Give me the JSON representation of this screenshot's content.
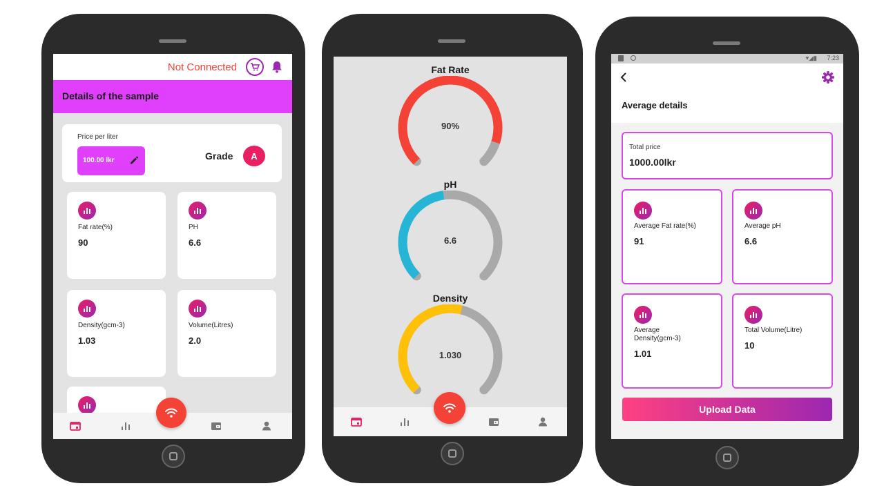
{
  "screen1": {
    "status_text": "Not Connected",
    "header_title": "Details of the sample",
    "price_label": "Price per liter",
    "price_value": "100.00 lkr",
    "grade_label": "Grade",
    "grade_value": "A",
    "metrics": [
      {
        "label": "Fat rate(%)",
        "value": "90"
      },
      {
        "label": "PH",
        "value": "6.6"
      },
      {
        "label": "Density(gcm-3)",
        "value": "1.03"
      },
      {
        "label": "Volume(Litres)",
        "value": "2.0"
      }
    ],
    "nav_icons": [
      "calendar-icon",
      "chart-icon",
      "wifi-icon",
      "wallet-icon",
      "person-icon"
    ]
  },
  "screen2": {
    "gauges": [
      {
        "title": "Fat Rate",
        "value_text": "90%",
        "fraction": 0.9,
        "color": "#f44336"
      },
      {
        "title": "pH",
        "value_text": "6.6",
        "fraction": 0.47,
        "color": "#26b5d4"
      },
      {
        "title": "Density",
        "value_text": "1.030",
        "fraction": 0.55,
        "color": "#ffc107"
      }
    ]
  },
  "screen3": {
    "time": "7:23",
    "title": "Average details",
    "total_price_label": "Total price",
    "total_price_value": "1000.00lkr",
    "metrics": [
      {
        "label": "Average Fat rate(%)",
        "value": "91"
      },
      {
        "label": "Average pH",
        "value": "6.6"
      },
      {
        "label": "Average Density(gcm-3)",
        "value": "1.01"
      },
      {
        "label": "Total Volume(Litre)",
        "value": "10"
      }
    ],
    "upload_label": "Upload Data"
  },
  "colors": {
    "accent_magenta": "#e040fb",
    "alert_red": "#f44336",
    "badge_pink": "#e91e63",
    "purple": "#9c27b0"
  }
}
